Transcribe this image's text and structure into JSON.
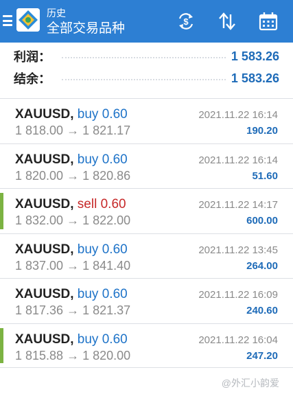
{
  "header": {
    "subtitle": "历史",
    "title": "全部交易品种",
    "icons": [
      "menu-icon",
      "metatrader-logo",
      "currency-exchange-icon",
      "sort-icon",
      "calendar-icon"
    ],
    "colors": {
      "bar": "#2d7fd3",
      "text": "#ffffff"
    }
  },
  "summary": {
    "profit_label": "利润：",
    "profit_value": "1 583.26",
    "balance_label": "结余：",
    "balance_value": "1 583.26"
  },
  "deals": [
    {
      "symbol": "XAUUSD,",
      "type": "buy",
      "volume": "0.60",
      "prices": "1 818.00 → 1 821.17",
      "time": "2021.11.22 16:14",
      "profit": "190.20",
      "marked": false
    },
    {
      "symbol": "XAUUSD,",
      "type": "buy",
      "volume": "0.60",
      "prices": "1 820.00 → 1 820.86",
      "time": "2021.11.22 16:14",
      "profit": "51.60",
      "marked": false
    },
    {
      "symbol": "XAUUSD,",
      "type": "sell",
      "volume": "0.60",
      "prices": "1 832.00 → 1 822.00",
      "time": "2021.11.22 14:17",
      "profit": "600.00",
      "marked": true
    },
    {
      "symbol": "XAUUSD,",
      "type": "buy",
      "volume": "0.60",
      "prices": "1 837.00 → 1 841.40",
      "time": "2021.11.22 13:45",
      "profit": "264.00",
      "marked": false
    },
    {
      "symbol": "XAUUSD,",
      "type": "buy",
      "volume": "0.60",
      "prices": "1 817.36 → 1 821.37",
      "time": "2021.11.22 16:09",
      "profit": "240.60",
      "marked": false
    },
    {
      "symbol": "XAUUSD,",
      "type": "buy",
      "volume": "0.60",
      "prices": "1 815.88 → 1 820.00",
      "time": "2021.11.22 16:04",
      "profit": "247.20",
      "marked": true
    }
  ],
  "colors": {
    "buy": "#1e73c8",
    "sell": "#c62828",
    "profit": "#1e6bb8",
    "marker": "#7cb342"
  },
  "watermark": "@外汇小韵爱"
}
